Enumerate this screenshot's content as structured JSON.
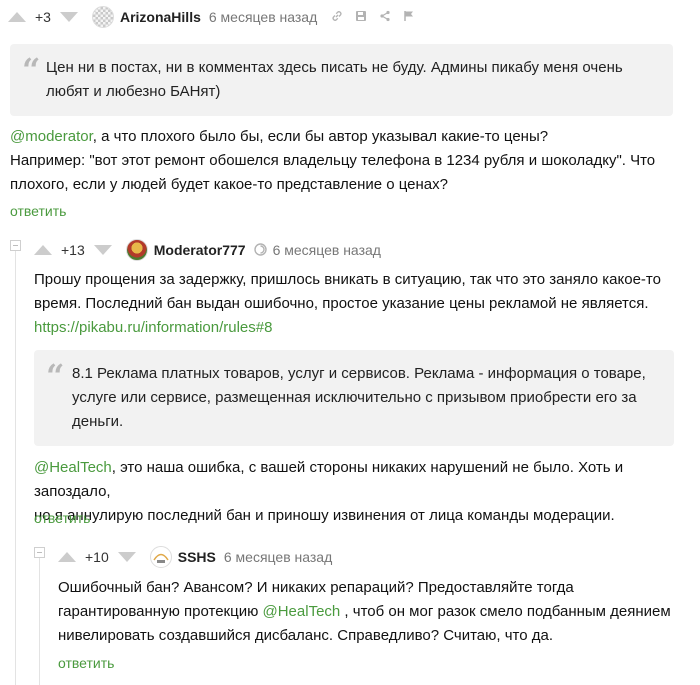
{
  "comments": [
    {
      "rating": "+3",
      "username": "ArizonaHills",
      "time": "6 месяцев назад",
      "quote": "Цен ни в постах, ни в комментах здесь писать не буду. Админы пикабу меня очень любят и любезно БАНят)",
      "body_mention": "@moderator",
      "body_line1_rest": ", а что плохого было бы, если бы автор указывал какие-то цены?",
      "body_line2": "Например: \"вот этот ремонт обошелся владельцу телефона в 1234 рубля и шоколадку\". Что",
      "body_line3": "плохого, если у людей будет какое-то представление о ценах?",
      "reply": "ответить"
    },
    {
      "rating": "+13",
      "username": "Moderator777",
      "time": "6 месяцев назад",
      "body_line1": "Прошу прощения за задержку, пришлось вникать в ситуацию, так что это заняло какое-то",
      "body_line2": "время. Последний бан выдан ошибочно, простое указание цены рекламой не является.",
      "link": "https://pikabu.ru/information/rules#8",
      "quote_line1": "8.1 Реклама платных товаров, услуг и сервисов. Реклама - информация о товаре,",
      "quote_line2": "услуге или сервисе, размещенная исключительно с призывом приобрести его за",
      "quote_line3": "деньги.",
      "body2_mention": "@HealTech",
      "body2_line1_rest": ", это наша ошибка, с вашей стороны никаких нарушений не было. Хоть и запоздало,",
      "body2_line2": "но я аннулирую последний бан и приношу извинения от лица команды модерации.",
      "reply": "ответить"
    },
    {
      "rating": "+10",
      "username": "SSHS",
      "time": "6 месяцев назад",
      "body_line1": "Ошибочный бан? Авансом? И никаких репараций? Предоставляйте тогда",
      "body_line2_pre": "гарантированную протекцию ",
      "body_mention": "@HealTech",
      "body_line2_post": " , чтоб он мог разок смело подбанным деянием",
      "body_line3": "нивелировать создавшийся дисбаланс. Справедливо? Считаю, что да.",
      "reply": "ответить"
    }
  ],
  "colors": {
    "accent": "#4a9a3e",
    "quote_bg": "#f2f2f2",
    "muted": "#777777"
  }
}
